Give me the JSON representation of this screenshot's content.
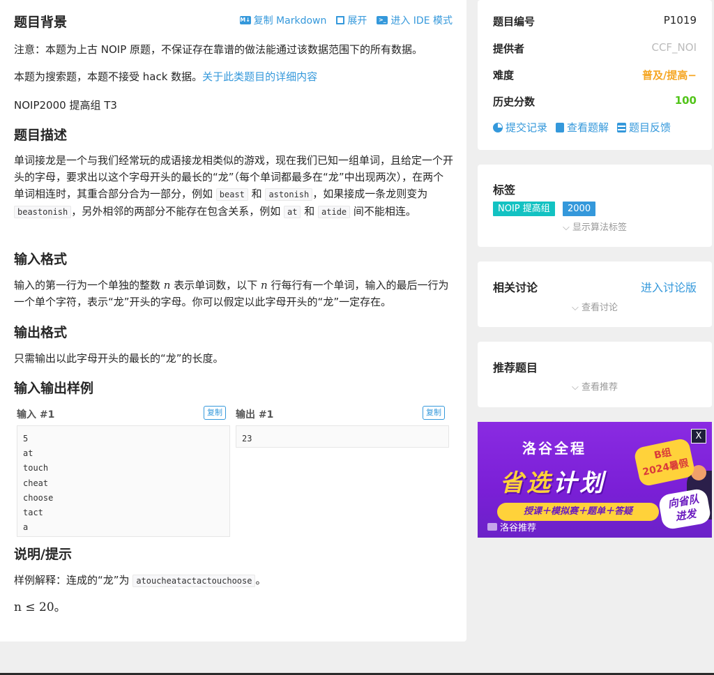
{
  "problem": {
    "bg_title": "题目背景",
    "actions": {
      "copy_markdown": "复制 Markdown",
      "expand": "展开",
      "ide_mode": "进入 IDE 模式",
      "md_icon_text": "M↓"
    },
    "bg_note": "注意：本题为上古 NOIP 原题，不保证存在靠谱的做法能通过该数据范围下的所有数据。",
    "bg_search_prefix": "本题为搜索题，本题不接受 hack 数据。",
    "bg_search_link": "关于此类题目的详细内容",
    "bg_source": "NOIP2000 提高组 T3",
    "desc_title": "题目描述",
    "desc_p1": "单词接龙是一个与我们经常玩的成语接龙相类似的游戏，现在我们已知一组单词，且给定一个开头的字母，要求出以这个字母开头的最长的“龙”（每个单词都最多在“龙”中出现两次），在两个单词相连时，其重合部分合为一部分，例如 ",
    "desc_code1": "beast",
    "desc_and1": " 和 ",
    "desc_code2": "astonish",
    "desc_p2": "，如果接成一条龙则变为 ",
    "desc_code3": "beastonish",
    "desc_p3": "，另外相邻的两部分不能存在包含关系，例如 ",
    "desc_code4": "at",
    "desc_and2": " 和 ",
    "desc_code5": "atide",
    "desc_p4": " 间不能相连。",
    "input_title": "输入格式",
    "input_p1": "输入的第一行为一个单独的整数 ",
    "input_var1": "n",
    "input_p2": " 表示单词数，以下 ",
    "input_var2": "n",
    "input_p3": " 行每行有一个单词，输入的最后一行为一个单个字符，表示“龙”开头的字母。你可以假定以此字母开头的“龙”一定存在。",
    "output_title": "输出格式",
    "output_text": "只需输出以此字母开头的最长的“龙”的长度。",
    "samples_title": "输入输出样例",
    "input_label": "输入 #1",
    "output_label": "输出 #1",
    "copy_label": "复制",
    "sample_input": "5\nat\ntouch\ncheat\nchoose\ntact\na",
    "sample_output": "23",
    "hint_title": "说明/提示",
    "hint_prefix": "样例解释：连成的“龙”为 ",
    "hint_code": "atoucheatactactouchoose",
    "hint_suffix": "。",
    "hint_math": "n ≤ 20。"
  },
  "info": {
    "rows": [
      {
        "key": "题目编号",
        "value": "P1019",
        "color": "#262626"
      },
      {
        "key": "提供者",
        "value": "CCF_NOI",
        "color": "#bbbbbb"
      },
      {
        "key": "难度",
        "value": "普及/提高−",
        "color": "#f5a623"
      },
      {
        "key": "历史分数",
        "value": "100",
        "color": "#52c41a"
      }
    ],
    "links": {
      "submissions": "提交记录",
      "solutions": "查看题解",
      "feedback": "题目反馈"
    }
  },
  "tags_card": {
    "title": "标签",
    "tags": [
      {
        "label": "NOIP 提高组",
        "color": "#13c2c2"
      },
      {
        "label": "2000",
        "color": "#3498db"
      }
    ],
    "toggle": "显示算法标签"
  },
  "discuss_card": {
    "title": "相关讨论",
    "link": "进入讨论版",
    "toggle": "查看讨论"
  },
  "recommend_card": {
    "title": "推荐题目",
    "toggle": "查看推荐"
  },
  "ad": {
    "brand": "洛谷全程",
    "headline_a": "省选",
    "headline_b": "计划",
    "badge": "B组\n2024暑假",
    "bar": "授课＋模拟赛＋题单＋答疑",
    "side": "向省队\n进发",
    "foot": "洛谷推荐",
    "close": "X"
  }
}
